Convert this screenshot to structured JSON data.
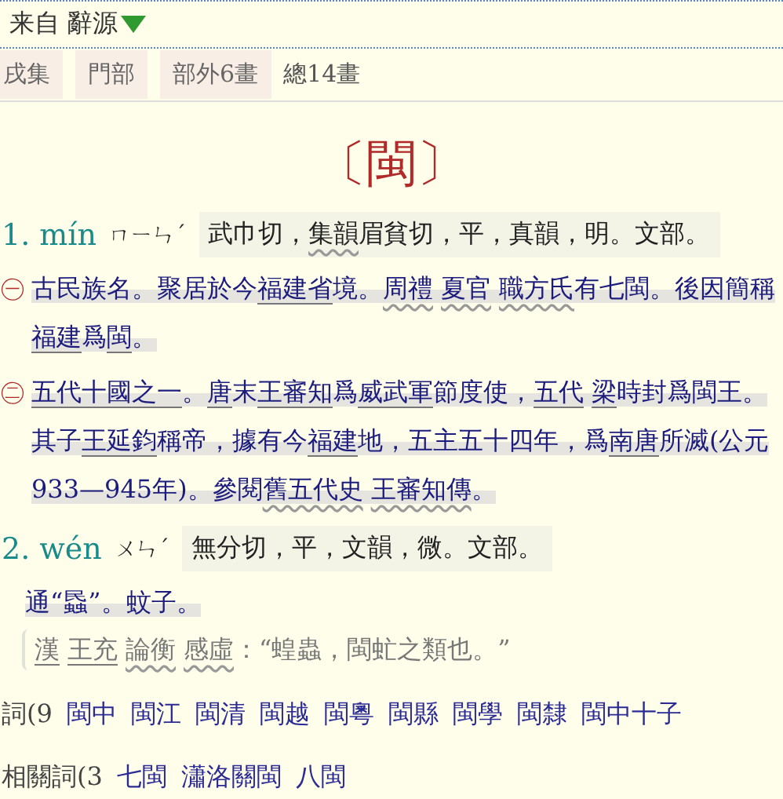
{
  "source": {
    "prefix": "来自",
    "name": "辭源"
  },
  "tags": [
    {
      "text": "戌集",
      "kind": "tag"
    },
    {
      "text": "門部",
      "kind": "tag"
    },
    {
      "text": "部外6畫",
      "kind": "tag"
    },
    {
      "text": "總14畫",
      "kind": "plain"
    }
  ],
  "headword": {
    "open": "〔",
    "char": "閩",
    "close": "〕"
  },
  "senses": [
    {
      "number": "1.",
      "pinyin": "mín",
      "zhuyin": "ㄇㄧㄣˊ",
      "fanqie": [
        {
          "kind": "plain",
          "text": "武巾切，"
        },
        {
          "kind": "book",
          "text": "集韻"
        },
        {
          "kind": "plain",
          "text": "眉貧切，平，真韻，明。文部。"
        }
      ],
      "definitions": [
        {
          "marker": "㊀",
          "segments": [
            {
              "kind": "plain",
              "text": "古民族名。聚居於今"
            },
            {
              "kind": "name",
              "text": "福建省"
            },
            {
              "kind": "plain",
              "text": "境。"
            },
            {
              "kind": "book",
              "text": "周禮"
            },
            {
              "kind": "book",
              "text": "夏官"
            },
            {
              "kind": "book",
              "text": "職方氏"
            },
            {
              "kind": "plain",
              "text": "有七閩。後因簡稱"
            },
            {
              "kind": "name",
              "text": "福建"
            },
            {
              "kind": "plain",
              "text": "爲"
            },
            {
              "kind": "name",
              "text": "閩"
            },
            {
              "kind": "plain",
              "text": "。"
            }
          ]
        },
        {
          "marker": "㊁",
          "segments": [
            {
              "kind": "name",
              "text": "五代十國之一"
            },
            {
              "kind": "plain",
              "text": "。"
            },
            {
              "kind": "name",
              "text": "唐"
            },
            {
              "kind": "plain",
              "text": "末"
            },
            {
              "kind": "name",
              "text": "王審知"
            },
            {
              "kind": "plain",
              "text": "爲"
            },
            {
              "kind": "name",
              "text": "威武軍"
            },
            {
              "kind": "plain",
              "text": "節度使，"
            },
            {
              "kind": "name",
              "text": "五代"
            },
            {
              "kind": "name",
              "text": "梁"
            },
            {
              "kind": "plain",
              "text": "時封爲閩王。其子"
            },
            {
              "kind": "name",
              "text": "王延鈞"
            },
            {
              "kind": "plain",
              "text": "稱帝，據有今"
            },
            {
              "kind": "name",
              "text": "福建"
            },
            {
              "kind": "plain",
              "text": "地，五主五十四年，爲"
            },
            {
              "kind": "name",
              "text": "南唐"
            },
            {
              "kind": "plain",
              "text": "所滅(公元933—945年)。參閱"
            },
            {
              "kind": "book",
              "text": "舊五代史"
            },
            {
              "kind": "book",
              "text": "王審知傳"
            },
            {
              "kind": "plain",
              "text": "。"
            }
          ]
        }
      ]
    },
    {
      "number": "2.",
      "pinyin": "wén",
      "zhuyin": "ㄨㄣˊ",
      "fanqie": [
        {
          "kind": "plain",
          "text": "無分切，平，文韻，微。文部。"
        }
      ],
      "definitions": [
        {
          "segments": [
            {
              "kind": "plain",
              "text": "通“蟁”。蚊子。"
            }
          ]
        }
      ],
      "quote": [
        {
          "kind": "name",
          "text": "漢"
        },
        {
          "kind": "name",
          "text": "王充"
        },
        {
          "kind": "book",
          "text": "論衡"
        },
        {
          "kind": "book",
          "text": "感虛"
        },
        {
          "kind": "plain",
          "text": "：“蝗蟲，閩虻之類也。”"
        }
      ]
    }
  ],
  "word_lists": [
    {
      "label": "詞(9",
      "words": [
        "閩中",
        "閩江",
        "閩清",
        "閩越",
        "閩粵",
        "閩縣",
        "閩學",
        "閩隸",
        "閩中十子"
      ]
    },
    {
      "label": "相關詞(3",
      "words": [
        "七閩",
        "瀟洛關閩",
        "八閩"
      ]
    }
  ]
}
